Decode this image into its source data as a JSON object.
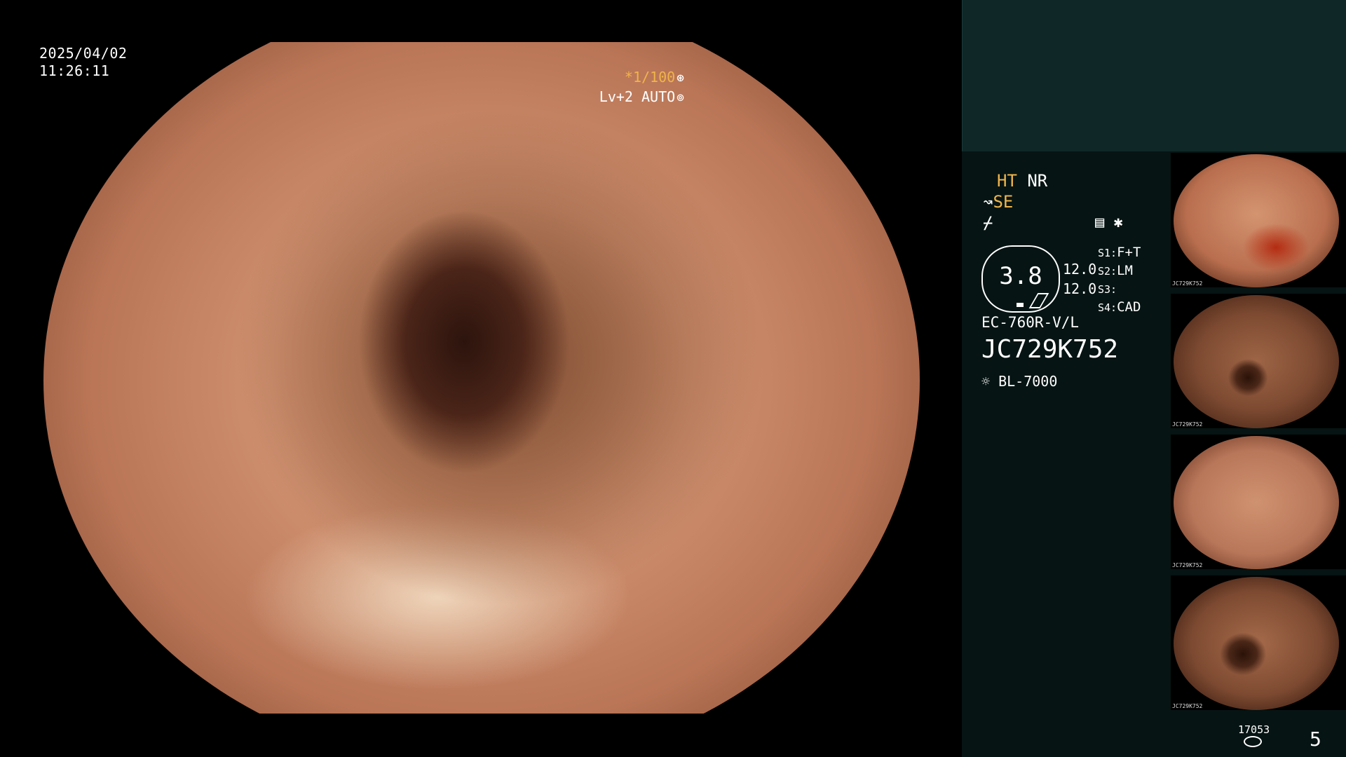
{
  "overlay": {
    "date": "2025/04/02",
    "time": "11:26:11",
    "shutter": "*1/100",
    "level": "Lv+2 AUTO"
  },
  "panel": {
    "mode_ht": "HT",
    "mode_nr": "NR",
    "mode_se": "SE",
    "value_main": "3.8",
    "value_1": "12.0",
    "value_2": "12.0",
    "settings": [
      {
        "key": "S1:",
        "value": "F+T"
      },
      {
        "key": "S2:",
        "value": "LM"
      },
      {
        "key": "S3:",
        "value": ""
      },
      {
        "key": "S4:",
        "value": "CAD"
      }
    ],
    "model": "EC-760R-V/L",
    "serial": "JC729K752",
    "light_source": "BL-7000"
  },
  "thumbnails": [
    {
      "label": "JC729K752"
    },
    {
      "label": "JC729K752"
    },
    {
      "label": "JC729K752"
    },
    {
      "label": "JC729K752"
    }
  ],
  "footer": {
    "count": "17053",
    "page": "5"
  },
  "colors": {
    "accent": "#f0b44a",
    "panel_bg": "#061413",
    "panel_top": "#0f2727"
  }
}
